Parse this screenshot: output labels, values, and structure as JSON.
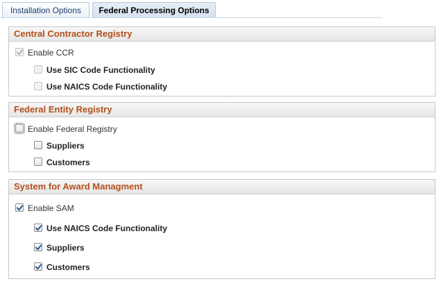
{
  "tabs": [
    {
      "label": "Installation Options",
      "active": false
    },
    {
      "label": "Federal Processing Options",
      "active": true
    }
  ],
  "ccr": {
    "title": "Central Contractor Registry",
    "enable": {
      "label": "Enable CCR",
      "checked": true,
      "disabled": true
    },
    "sic": {
      "label": "Use SIC Code Functionality",
      "checked": false,
      "disabled": true
    },
    "naics": {
      "label": "Use NAICS Code Functionality",
      "checked": false,
      "disabled": true
    }
  },
  "federal_entity": {
    "title": "Federal Entity Registry",
    "enable": {
      "label": "Enable Federal Registry",
      "checked": false,
      "disabled": false
    },
    "suppliers": {
      "label": "Suppliers",
      "checked": false,
      "disabled": false
    },
    "customers": {
      "label": "Customers",
      "checked": false,
      "disabled": false
    }
  },
  "sam": {
    "title": "System for Award Managment",
    "enable": {
      "label": "Enable SAM",
      "checked": true,
      "disabled": false
    },
    "naics": {
      "label": "Use NAICS Code Functionality",
      "checked": true,
      "disabled": false
    },
    "suppliers": {
      "label": "Suppliers",
      "checked": true,
      "disabled": false
    },
    "customers": {
      "label": "Customers",
      "checked": true,
      "disabled": false
    }
  },
  "colors": {
    "section_title": "#b3501a",
    "check_enabled": "#1c4f8c",
    "check_disabled": "#a8a8a8"
  }
}
